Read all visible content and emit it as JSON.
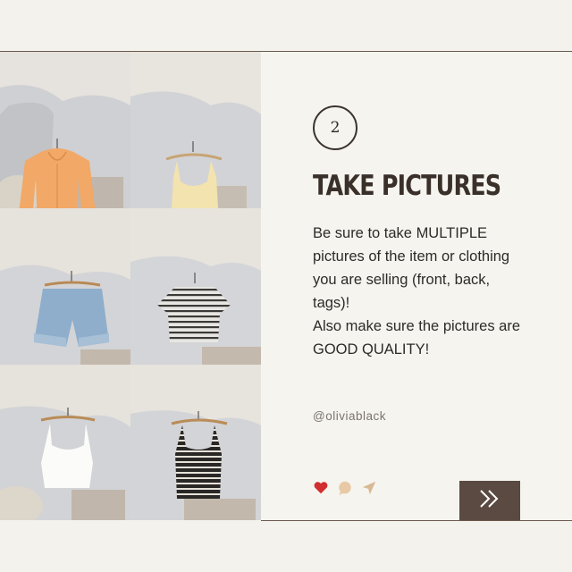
{
  "step": {
    "number": "2",
    "title": "TAKE PICTURES"
  },
  "body": {
    "lines": [
      "Be sure to take MULTIPLE",
      "pictures of the item or clothing",
      "you are selling (front, back,",
      "tags)!",
      "Also make sure the pictures are",
      "GOOD QUALITY!"
    ]
  },
  "author": {
    "handle": "@oliviablack"
  },
  "icons": [
    "heart-icon",
    "comment-icon",
    "send-icon",
    "double-chevron-right-icon"
  ],
  "photos": [
    {
      "item": "orange-cardigan-photo",
      "color": "#f0a860"
    },
    {
      "item": "cream-tank-photo",
      "color": "#f3e2ad"
    },
    {
      "item": "denim-shorts-photo",
      "color": "#88a9c7"
    },
    {
      "item": "striped-tee-photo",
      "color": "#bdbcb8"
    },
    {
      "item": "white-cami-photo",
      "color": "#f8f8f6"
    },
    {
      "item": "striped-tank-photo",
      "color": "#2a2826"
    }
  ],
  "colors": {
    "accent": "#5a4a41",
    "heart": "#d12f2f",
    "comment": "#e7c9a6",
    "send": "#d9b894"
  }
}
